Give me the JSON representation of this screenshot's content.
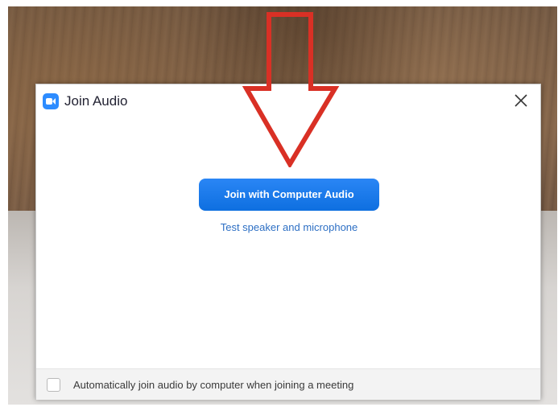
{
  "dialog": {
    "title": "Join Audio",
    "app_icon": "camera-icon",
    "close_icon": "close-icon"
  },
  "main": {
    "join_button_label": "Join with Computer Audio",
    "test_link_label": "Test speaker and microphone"
  },
  "footer": {
    "auto_join_checked": false,
    "auto_join_label": "Automatically join audio by computer when joining a meeting"
  },
  "annotation": {
    "arrow_color": "#d93025",
    "arrow_icon": "down-arrow-icon"
  },
  "colors": {
    "accent": "#2d8cff",
    "button": "#1a73e8",
    "link": "#2d6fc4"
  }
}
